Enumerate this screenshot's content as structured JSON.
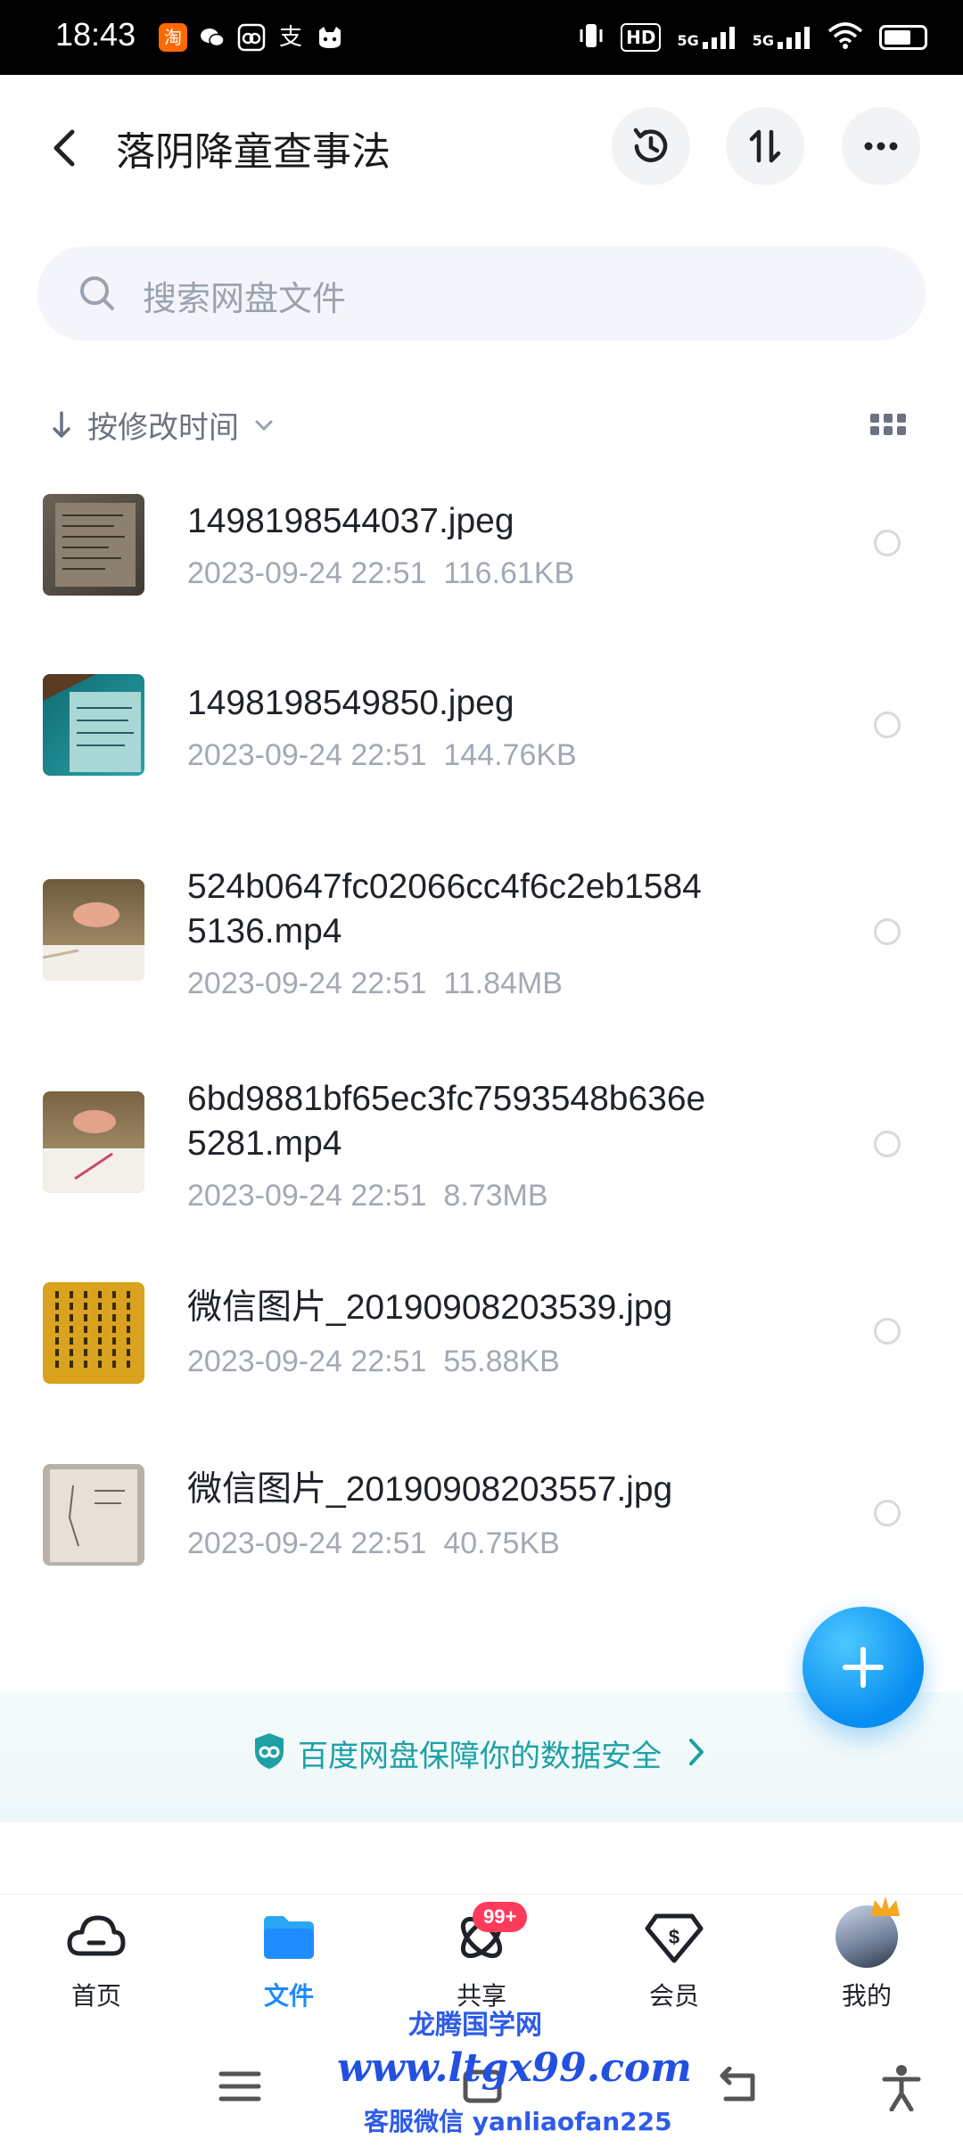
{
  "status_bar": {
    "time": "18:43",
    "app_icons": [
      "taobao-icon",
      "wechat-icon",
      "baidu-netdisk-icon",
      "alipay-icon",
      "cat-app-icon"
    ],
    "taobao_glyph": "淘",
    "alipay_glyph": "支",
    "signal": [
      "HD",
      "5G",
      "5G"
    ]
  },
  "header": {
    "title": "落阴降童查事法",
    "buttons": [
      "history-icon",
      "transfer-icon",
      "more-icon"
    ]
  },
  "search": {
    "placeholder": "搜索网盘文件"
  },
  "sort": {
    "label": "按修改时间"
  },
  "files": [
    {
      "name": "1498198544037.jpeg",
      "date": "2023-09-24  22:51",
      "size": "116.61KB",
      "thumb": "notes"
    },
    {
      "name": "1498198549850.jpeg",
      "date": "2023-09-24  22:51",
      "size": "144.76KB",
      "thumb": "teal"
    },
    {
      "name": "524b0647fc02066cc4f6c2eb15845136.mp4",
      "name_line1": "524b0647fc02066cc4f6c2eb1584",
      "name_line2": "5136.mp4",
      "date": "2023-09-24  22:51",
      "size": "11.84MB",
      "thumb": "video"
    },
    {
      "name": "6bd9881bf65ec3fc7593548b636e5281.mp4",
      "name_line1": "6bd9881bf65ec3fc7593548b636e",
      "name_line2": "5281.mp4",
      "date": "2023-09-24  22:51",
      "size": "8.73MB",
      "thumb": "video"
    },
    {
      "name": "微信图片_20190908203539.jpg",
      "date": "2023-09-24  22:51",
      "size": "55.88KB",
      "thumb": "gold"
    },
    {
      "name": "微信图片_20190908203557.jpg",
      "date": "2023-09-24  22:51",
      "size": "40.75KB",
      "thumb": "paper"
    }
  ],
  "security_banner": {
    "text": "百度网盘保障你的数据安全"
  },
  "bottom_nav": {
    "items": [
      {
        "label": "首页",
        "icon": "cloud-home-icon"
      },
      {
        "label": "文件",
        "icon": "folder-icon",
        "active": true
      },
      {
        "label": "共享",
        "icon": "share-orbit-icon",
        "badge": "99+"
      },
      {
        "label": "会员",
        "icon": "vip-diamond-icon"
      },
      {
        "label": "我的",
        "icon": "avatar"
      }
    ]
  },
  "watermark": {
    "line1": "龙腾国学网",
    "line2": "www.ltgx99.com",
    "line3": "客服微信 yanliaofan225"
  },
  "colors": {
    "accent": "#1e8cff",
    "badge": "#ff3b5c",
    "security": "#1da1a5"
  }
}
